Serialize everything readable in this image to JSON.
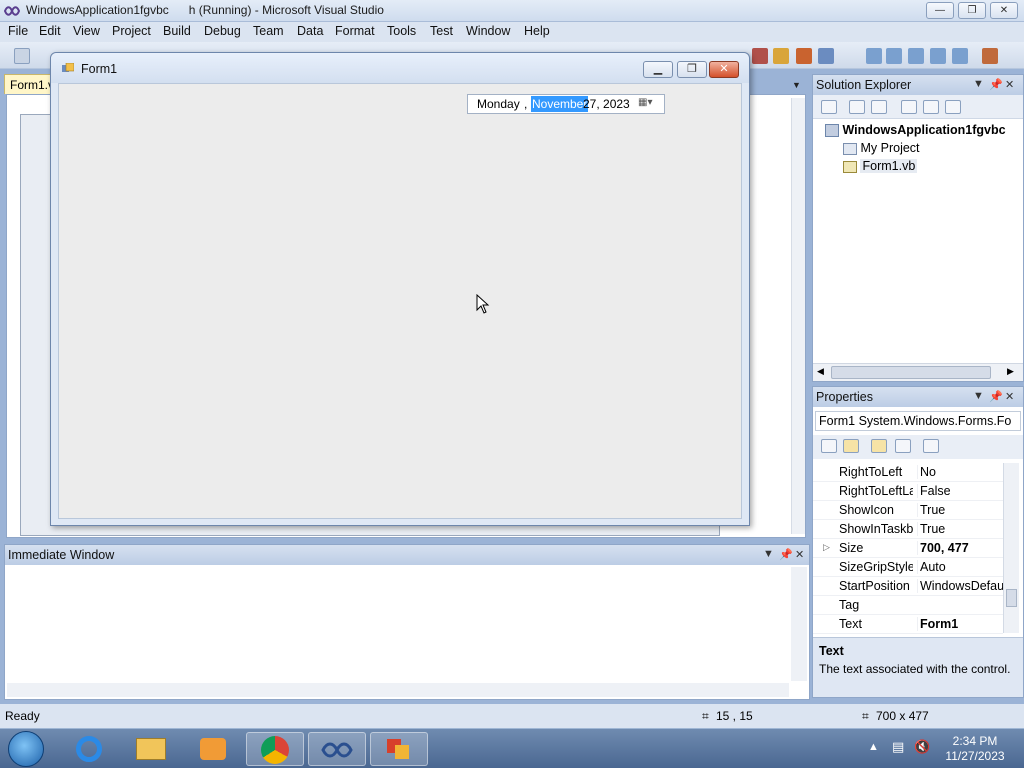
{
  "vs_window": {
    "title": "WindowsApplication1fgvbc      h (Running) - Microsoft Visual Studio",
    "caption_buttons": {
      "minimize": "—",
      "restore": "❐",
      "close": "✕"
    }
  },
  "menu": [
    "File",
    "Edit",
    "View",
    "Project",
    "Build",
    "Debug",
    "Team",
    "Data",
    "Format",
    "Tools",
    "Test",
    "Window",
    "Help"
  ],
  "document": {
    "tab_label": "Form1.v"
  },
  "form1": {
    "title": "Form1",
    "buttons": {
      "minimize": "▁",
      "restore": "❐",
      "close": "✕"
    },
    "date_picker": {
      "weekday": "Monday",
      "separator": ",",
      "month_selected": "November",
      "day_year": "27, 2023",
      "dropdown_icon": "calendar-dropdown-icon"
    }
  },
  "solution_explorer": {
    "header": "Solution Explorer",
    "tree": [
      {
        "label": "WindowsApplication1fgvbc",
        "icon": "solution-icon",
        "bold": true
      },
      {
        "label": "My Project",
        "icon": "project-properties-icon",
        "bold": false
      },
      {
        "label": "Form1.vb",
        "icon": "form-file-icon",
        "bold": false
      }
    ]
  },
  "properties": {
    "header": "Properties",
    "object": "Form1 System.Windows.Forms.Fo",
    "rows": [
      {
        "name": "RightToLeft",
        "value": "No",
        "bold": false,
        "expandable": false
      },
      {
        "name": "RightToLeftLa",
        "value": "False",
        "bold": false,
        "expandable": false
      },
      {
        "name": "ShowIcon",
        "value": "True",
        "bold": false,
        "expandable": false
      },
      {
        "name": "ShowInTaskba",
        "value": "True",
        "bold": false,
        "expandable": false
      },
      {
        "name": "Size",
        "value": "700, 477",
        "bold": true,
        "expandable": true
      },
      {
        "name": "SizeGripStyle",
        "value": "Auto",
        "bold": false,
        "expandable": false
      },
      {
        "name": "StartPosition",
        "value": "WindowsDefaul",
        "bold": false,
        "expandable": false
      },
      {
        "name": "Tag",
        "value": "",
        "bold": false,
        "expandable": false
      },
      {
        "name": "Text",
        "value": "Form1",
        "bold": true,
        "expandable": false
      }
    ],
    "description": {
      "title": "Text",
      "text": "The text associated with the control."
    }
  },
  "immediate_window": {
    "header": "Immediate Window"
  },
  "status_bar": {
    "left": "Ready",
    "position": "15 , 15",
    "size": "700 x 477"
  },
  "taskbar": {
    "apps": [
      "start-orb-icon",
      "internet-explorer-icon",
      "file-explorer-icon",
      "media-player-icon",
      "chrome-icon",
      "visual-studio-icon",
      "windows-forms-app-icon"
    ],
    "time": "2:34 PM",
    "date": "11/27/2023"
  }
}
